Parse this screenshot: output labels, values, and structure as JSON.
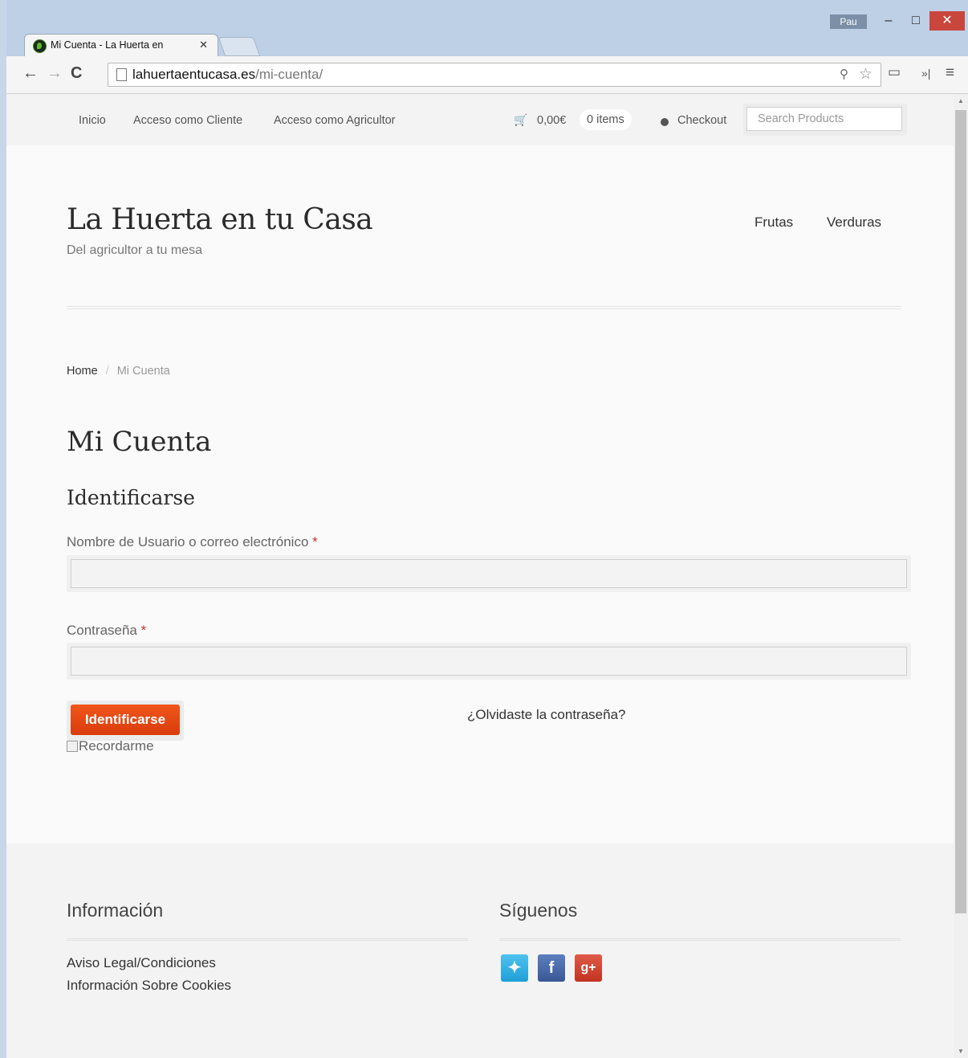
{
  "browser": {
    "user": "Pau",
    "tab_title": "Mi Cuenta - La Huerta en",
    "url_host": "lahuertaentucasa.es",
    "url_path": "/mi-cuenta/"
  },
  "topbar": {
    "nav": [
      "Inicio",
      "Acceso como Cliente",
      "Acceso como Agricultor"
    ],
    "cart_total": "0,00€",
    "cart_count": "0 items",
    "checkout": "Checkout",
    "search_placeholder": "Search Products"
  },
  "header": {
    "site_title": "La Huerta en tu Casa",
    "site_description": "Del agricultor a tu mesa",
    "main_nav": [
      "Frutas",
      "Verduras"
    ]
  },
  "breadcrumb": {
    "home": "Home",
    "separator": "/",
    "current": "Mi Cuenta"
  },
  "main": {
    "page_title": "Mi Cuenta",
    "login_heading": "Identificarse",
    "username_label": "Nombre de Usuario o correo electrónico",
    "password_label": "Contraseña",
    "required_mark": "*",
    "username_value": "",
    "password_value": "",
    "login_button": "Identificarse",
    "remember_label": "Recordarme",
    "lost_password": "¿Olvidaste la contraseña?"
  },
  "footer": {
    "info_heading": "Información",
    "info_links": [
      "Aviso Legal/Condiciones",
      "Información Sobre Cookies"
    ],
    "social_heading": "Síguenos",
    "social_icons": [
      "twitter-icon",
      "facebook-icon",
      "google-plus-icon"
    ]
  },
  "colors": {
    "accent": "#e24a12",
    "twitter": "#1f9fd7",
    "facebook": "#3a5795",
    "google_plus": "#c23321"
  }
}
